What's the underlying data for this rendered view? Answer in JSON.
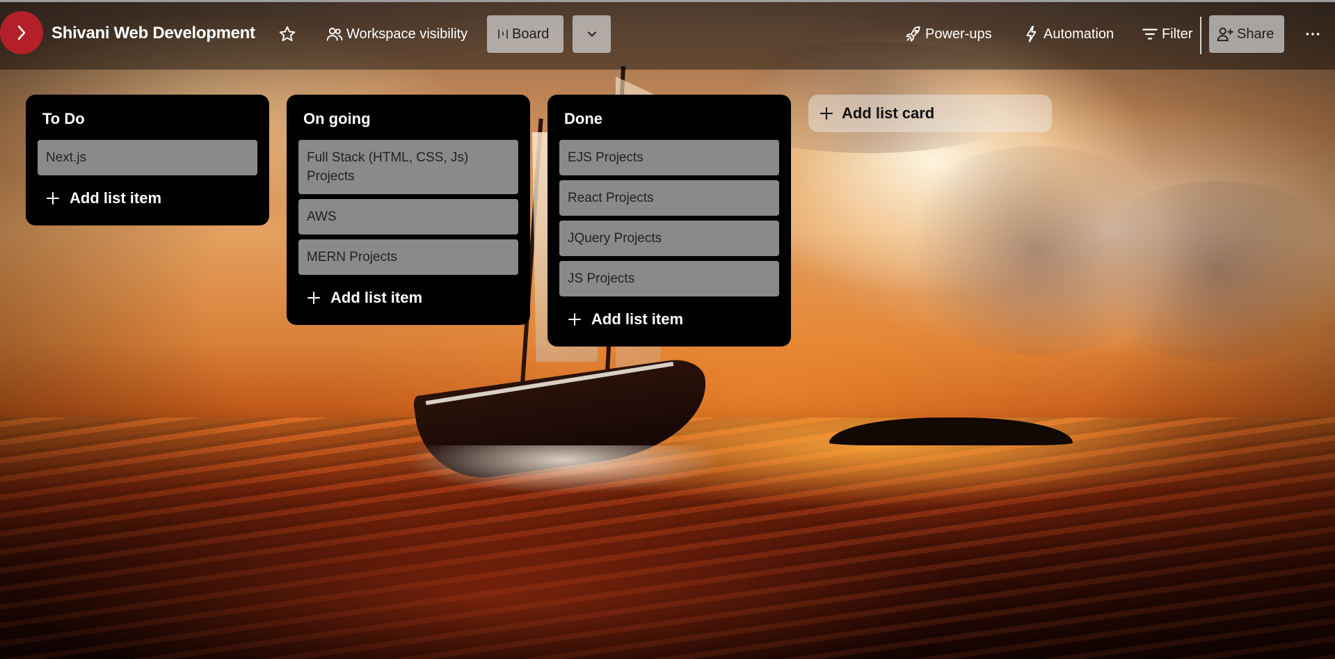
{
  "board": {
    "title": "Shivani Web Development"
  },
  "header": {
    "workspace_visibility": "Workspace visibility",
    "view_board": "Board",
    "power_ups": "Power-ups",
    "automation": "Automation",
    "filter": "Filter",
    "share": "Share"
  },
  "lists": [
    {
      "title": "To Do",
      "cards": [
        "Next.js"
      ],
      "add_item_label": "Add list item"
    },
    {
      "title": "On going",
      "cards": [
        "Full Stack (HTML, CSS, Js) Projects",
        "AWS",
        "MERN Projects"
      ],
      "add_item_label": "Add list item"
    },
    {
      "title": "Done",
      "cards": [
        "EJS Projects",
        "React Projects",
        "JQuery Projects",
        "JS Projects"
      ],
      "add_item_label": "Add list item"
    }
  ],
  "add_card_label": "Add list card",
  "colors": {
    "expand_button": "#b3202a",
    "list_background": "#000000",
    "card_background": "#8a8a8a"
  },
  "icons": {
    "expand": "chevron-right-icon",
    "star": "star-icon",
    "visibility": "people-icon",
    "board": "board-columns-icon",
    "view_menu": "chevron-down-icon",
    "power_ups": "rocket-icon",
    "automation": "lightning-icon",
    "filter": "filter-icon",
    "share": "add-person-icon",
    "more": "more-horizontal-icon",
    "add": "plus-icon"
  }
}
